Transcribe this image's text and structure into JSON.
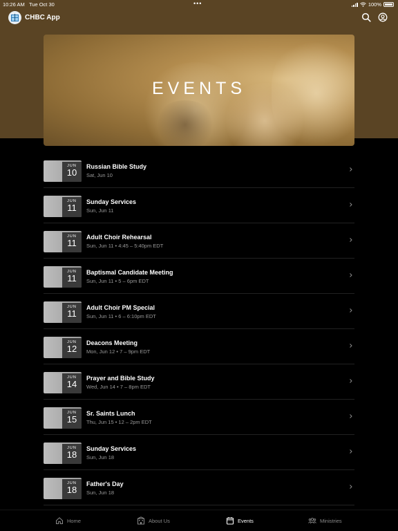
{
  "status": {
    "time": "10:26 AM",
    "date": "Tue Oct 30",
    "dots": "•••",
    "battery": "100%"
  },
  "header": {
    "app_title": "CHBC App",
    "icons": [
      "logo-icon",
      "search-icon",
      "account-icon"
    ]
  },
  "hero": {
    "title": "EVENTS"
  },
  "events": [
    {
      "month": "JUN",
      "day": "10",
      "title": "Russian Bible Study",
      "subtitle": "Sat, Jun 10"
    },
    {
      "month": "JUN",
      "day": "11",
      "title": "Sunday Services",
      "subtitle": "Sun, Jun 11"
    },
    {
      "month": "JUN",
      "day": "11",
      "title": "Adult Choir Rehearsal",
      "subtitle": "Sun, Jun 11 • 4:45 – 5:40pm EDT"
    },
    {
      "month": "JUN",
      "day": "11",
      "title": "Baptismal Candidate Meeting",
      "subtitle": "Sun, Jun 11 • 5 – 6pm EDT"
    },
    {
      "month": "JUN",
      "day": "11",
      "title": "Adult Choir PM Special",
      "subtitle": "Sun, Jun 11 • 6 – 6:10pm EDT"
    },
    {
      "month": "JUN",
      "day": "12",
      "title": "Deacons Meeting",
      "subtitle": "Mon, Jun 12 • 7 – 9pm EDT"
    },
    {
      "month": "JUN",
      "day": "14",
      "title": "Prayer and Bible Study",
      "subtitle": "Wed, Jun 14 • 7 – 8pm EDT"
    },
    {
      "month": "JUN",
      "day": "15",
      "title": "Sr. Saints Lunch",
      "subtitle": "Thu, Jun 15 • 12 – 2pm EDT"
    },
    {
      "month": "JUN",
      "day": "18",
      "title": "Sunday Services",
      "subtitle": "Sun, Jun 18"
    },
    {
      "month": "JUN",
      "day": "18",
      "title": "Father's Day",
      "subtitle": "Sun, Jun 18"
    }
  ],
  "tabs": [
    {
      "label": "Home",
      "icon": "home-icon",
      "active": false
    },
    {
      "label": "About Us",
      "icon": "building-icon",
      "active": false
    },
    {
      "label": "Events",
      "icon": "calendar-icon",
      "active": true
    },
    {
      "label": "Ministries",
      "icon": "people-icon",
      "active": false
    }
  ],
  "colors": {
    "header_band": "#5a4424",
    "background": "#000000",
    "subtitle_text": "#9a9a9a",
    "tab_inactive": "#8a8a8a"
  }
}
